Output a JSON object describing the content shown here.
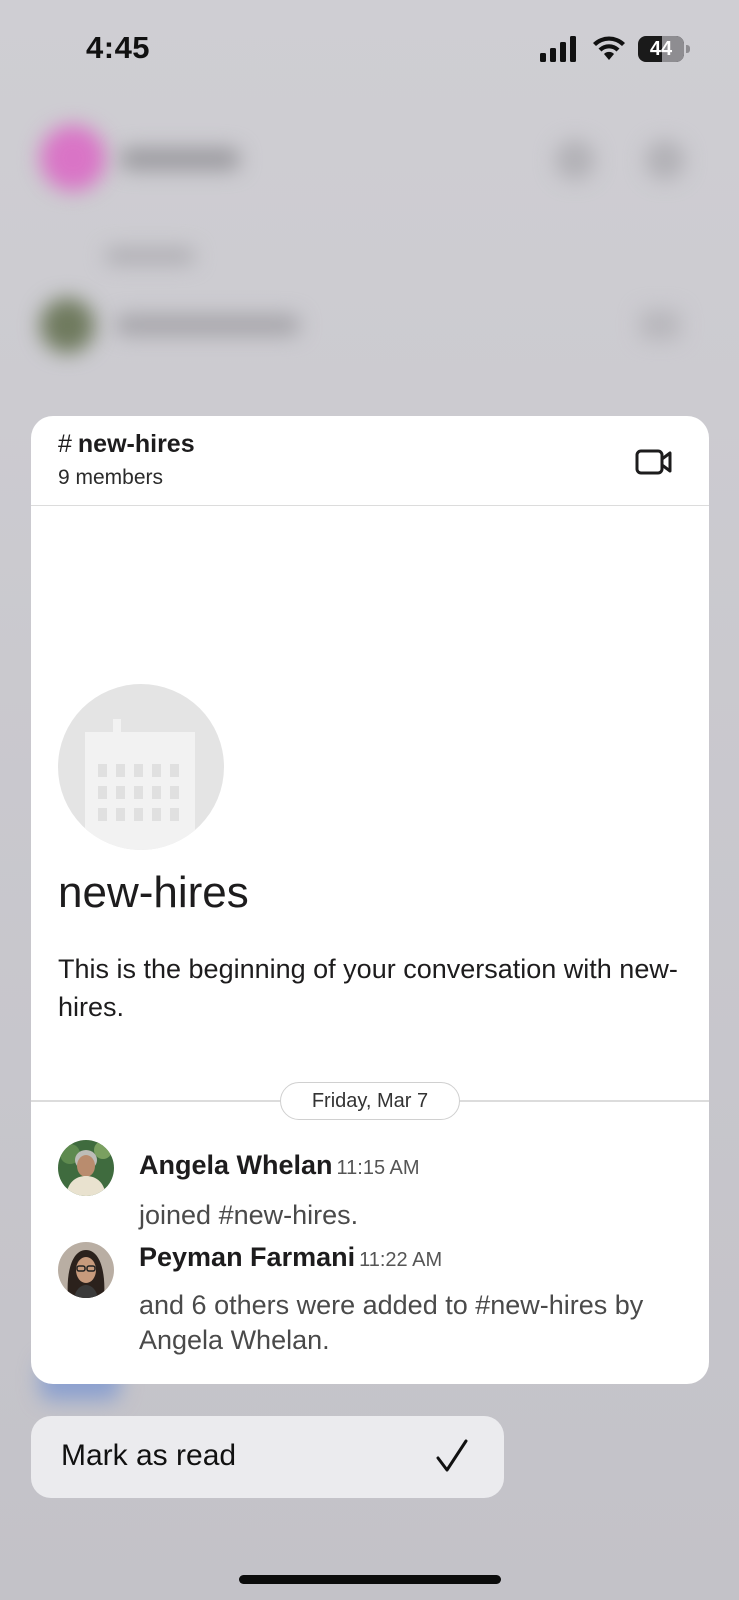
{
  "status_bar": {
    "time": "4:45",
    "battery": "44"
  },
  "channel": {
    "hash": "#",
    "name": "new-hires",
    "members": "9 members",
    "title_large": "new-hires",
    "intro": "This is the beginning of your conversation with new-hires."
  },
  "date_divider": "Friday, Mar 7",
  "messages": [
    {
      "author": "Angela Whelan",
      "time": "11:15 AM",
      "text": "joined #new-hires."
    },
    {
      "author": "Peyman Farmani",
      "time": "11:22 AM",
      "text": "and 6 others were added to #new-hires by Angela Whelan."
    }
  ],
  "menu": {
    "mark_as_read": "Mark as read"
  },
  "icons": {
    "video": "video-call-icon",
    "check": "checkmark-icon",
    "channel_avatar": "building-icon"
  },
  "colors": {
    "background_dim": "#c9c8cd",
    "card": "#ffffff",
    "menu_bg": "#ebebee",
    "text": "#1d1c1d"
  }
}
